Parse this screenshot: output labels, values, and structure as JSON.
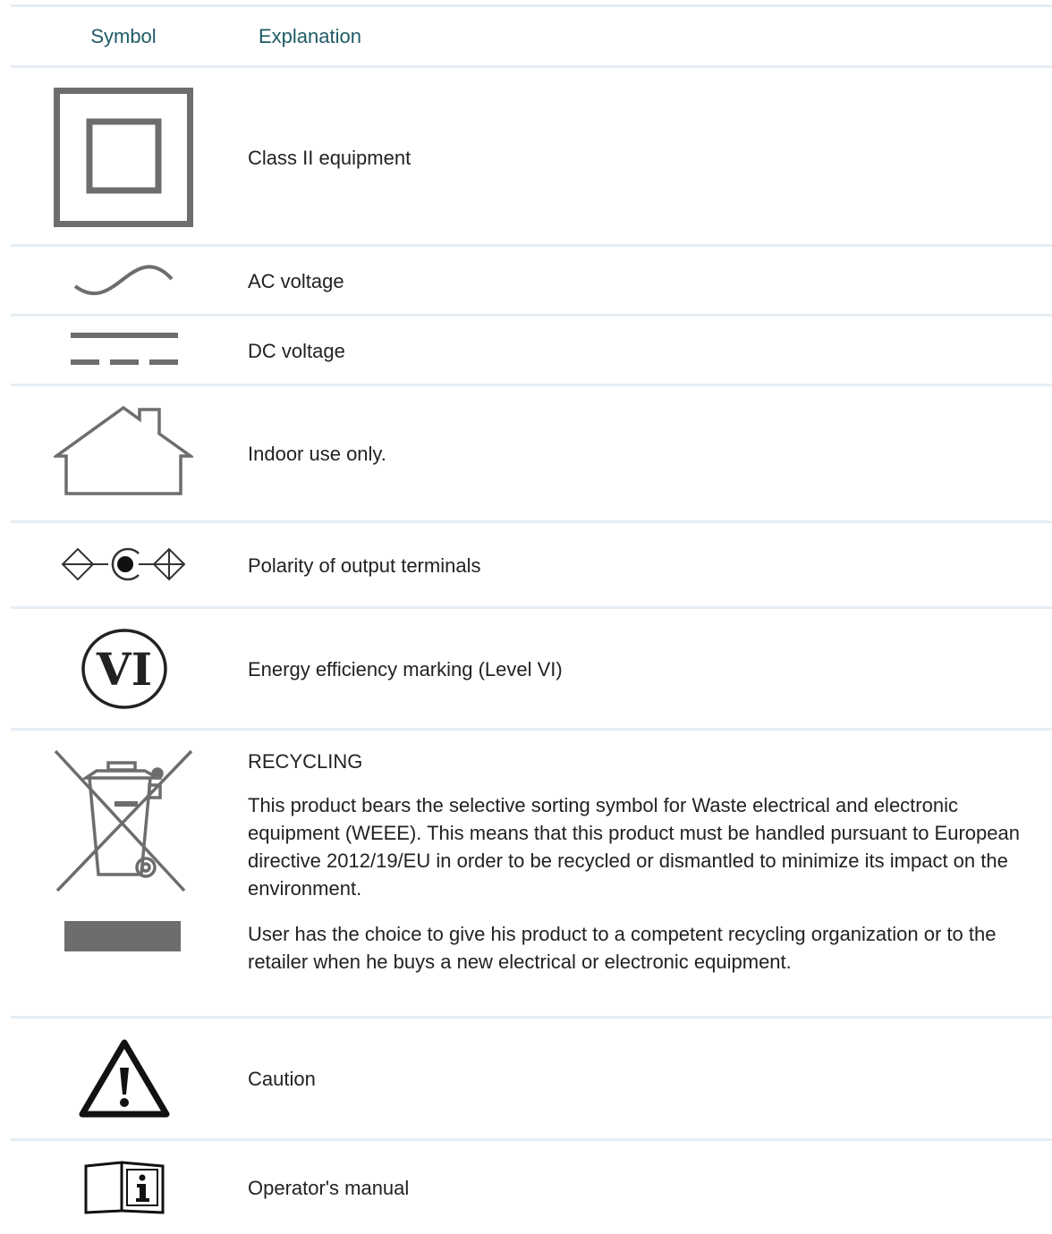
{
  "header": {
    "symbol": "Symbol",
    "explanation": "Explanation"
  },
  "rows": [
    {
      "icon": "class-ii-icon",
      "text": "Class II equipment"
    },
    {
      "icon": "ac-voltage-icon",
      "text": "AC voltage"
    },
    {
      "icon": "dc-voltage-icon",
      "text": "DC voltage"
    },
    {
      "icon": "indoor-house-icon",
      "text": "Indoor use only."
    },
    {
      "icon": "polarity-icon",
      "text": "Polarity of output terminals"
    },
    {
      "icon": "energy-level-vi-icon",
      "text": "Energy efficiency marking (Level VI)",
      "icon_label": "VI"
    },
    {
      "icon": "weee-bin-icon",
      "title": "RECYCLING",
      "para1": "This product bears the selective sorting symbol for Waste electrical and electronic equipment (WEEE). This means that this product must be handled pursuant to European directive 2012/19/EU in order to be recycled or dismantled to minimize its impact on the environment.",
      "para2": "User has the choice to give his product to a competent recycling organization or to the retailer when he buys a new electrical or electronic equipment."
    },
    {
      "icon": "caution-icon",
      "text": "Caution"
    },
    {
      "icon": "operator-manual-icon",
      "text": "Operator's manual"
    }
  ],
  "colors": {
    "header_text": "#1d5a66",
    "divider": "#e6eef4",
    "icon_gray": "#6d6d6d"
  }
}
